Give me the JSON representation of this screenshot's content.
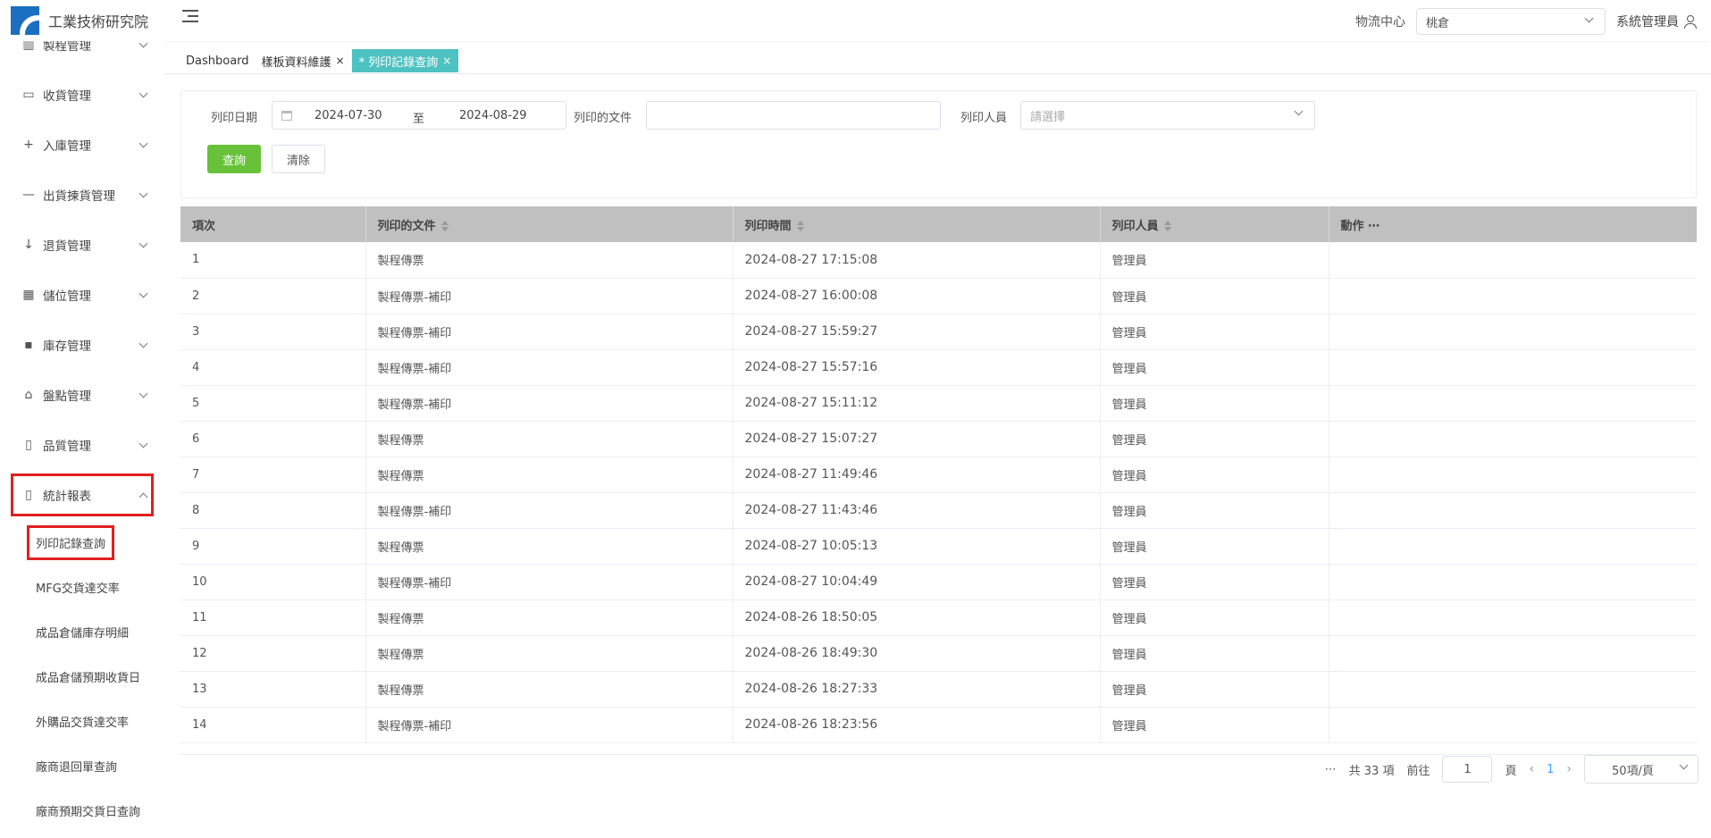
{
  "brand": {
    "title": "工業技術研究院"
  },
  "sidebar": {
    "items": [
      {
        "label": "製程管理",
        "icon": "factory-icon"
      },
      {
        "label": "收貨管理",
        "icon": "inbox-icon"
      },
      {
        "label": "入庫管理",
        "icon": "plus-icon"
      },
      {
        "label": "出貨揀貨管理",
        "icon": "minus-icon"
      },
      {
        "label": "退貨管理",
        "icon": "arrow-down-icon"
      },
      {
        "label": "儲位管理",
        "icon": "grid-icon"
      },
      {
        "label": "庫存管理",
        "icon": "dashboard-icon"
      },
      {
        "label": "盤點管理",
        "icon": "home-icon"
      },
      {
        "label": "品質管理",
        "icon": "document-icon"
      },
      {
        "label": "統計報表",
        "icon": "document-icon"
      }
    ],
    "submenu": [
      "列印記錄查詢",
      "MFG交貨達交率",
      "成品倉儲庫存明細",
      "成品倉儲預期收貨日",
      "外購品交貨達交率",
      "廠商退回單查詢",
      "廠商預期交貨日查詢"
    ]
  },
  "header": {
    "center_label": "物流中心",
    "center_value": "桃倉",
    "user": "系統管理員"
  },
  "tabs": [
    {
      "label": "Dashboard"
    },
    {
      "label": "樣板資料維護",
      "close": "×"
    },
    {
      "label": "* 列印記錄查詢",
      "close": "×"
    }
  ],
  "filters": {
    "date_label": "列印日期",
    "date_start": "2024-07-30",
    "date_sep": "至",
    "date_end": "2024-08-29",
    "doc_label": "列印的文件",
    "doc_value": "",
    "person_label": "列印人員",
    "person_placeholder": "請選擇",
    "query_button": "查詢",
    "clear_button": "清除"
  },
  "table": {
    "columns": [
      "項次",
      "列印的文件",
      "列印時間",
      "列印人員",
      "動作 ⋯"
    ],
    "rows": [
      [
        "1",
        "製程傳票",
        "2024-08-27 17:15:08",
        "管理員"
      ],
      [
        "2",
        "製程傳票-補印",
        "2024-08-27 16:00:08",
        "管理員"
      ],
      [
        "3",
        "製程傳票-補印",
        "2024-08-27 15:59:27",
        "管理員"
      ],
      [
        "4",
        "製程傳票-補印",
        "2024-08-27 15:57:16",
        "管理員"
      ],
      [
        "5",
        "製程傳票-補印",
        "2024-08-27 15:11:12",
        "管理員"
      ],
      [
        "6",
        "製程傳票",
        "2024-08-27 15:07:27",
        "管理員"
      ],
      [
        "7",
        "製程傳票",
        "2024-08-27 11:49:46",
        "管理員"
      ],
      [
        "8",
        "製程傳票-補印",
        "2024-08-27 11:43:46",
        "管理員"
      ],
      [
        "9",
        "製程傳票",
        "2024-08-27 10:05:13",
        "管理員"
      ],
      [
        "10",
        "製程傳票-補印",
        "2024-08-27 10:04:49",
        "管理員"
      ],
      [
        "11",
        "製程傳票",
        "2024-08-26 18:50:05",
        "管理員"
      ],
      [
        "12",
        "製程傳票",
        "2024-08-26 18:49:30",
        "管理員"
      ],
      [
        "13",
        "製程傳票",
        "2024-08-26 18:27:33",
        "管理員"
      ],
      [
        "14",
        "製程傳票-補印",
        "2024-08-26 18:23:56",
        "管理員"
      ]
    ]
  },
  "pagination": {
    "more": "⋯",
    "total": "共 33 項",
    "goto_label": "前往",
    "goto_value": "1",
    "page_suffix": "頁",
    "prev": "‹",
    "current": "1",
    "next": "›",
    "page_size": "50項/頁"
  }
}
